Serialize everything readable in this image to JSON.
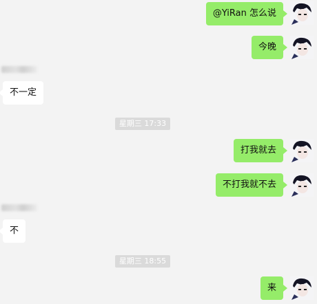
{
  "messages": [
    {
      "text": "@YiRan 怎么说"
    },
    {
      "text": "今晚"
    },
    {
      "text": "不一定"
    },
    {
      "text": "打我就去"
    },
    {
      "text": "不打我就不去"
    },
    {
      "text": "不"
    },
    {
      "text": "来"
    }
  ],
  "timestamps": [
    "星期三 17:33",
    "星期三 18:55"
  ]
}
